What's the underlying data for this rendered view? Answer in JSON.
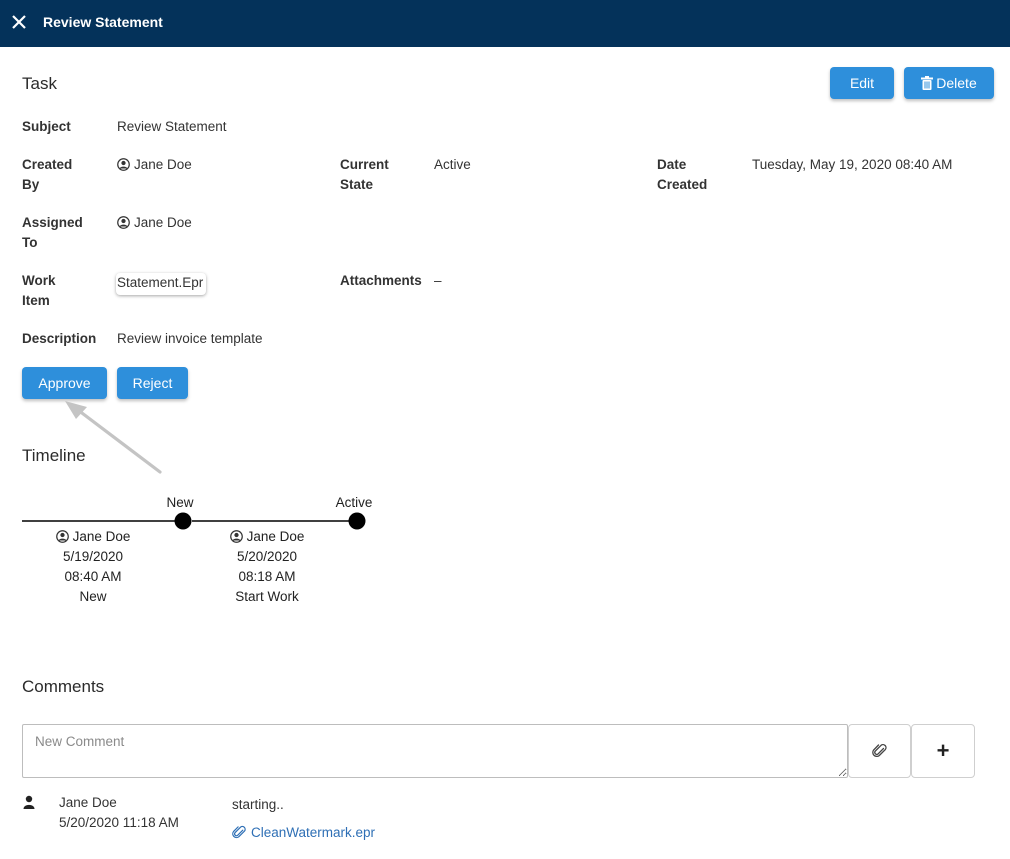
{
  "header": {
    "title": "Review Statement"
  },
  "task": {
    "heading": "Task",
    "edit_label": "Edit",
    "delete_label": "Delete",
    "subject_label": "Subject",
    "subject_value": "Review Statement",
    "created_by_label_1": "Created",
    "created_by_label_2": "By",
    "created_by_value": "Jane Doe",
    "current_state_label_1": "Current",
    "current_state_label_2": "State",
    "current_state_value": "Active",
    "date_created_label_1": "Date",
    "date_created_label_2": "Created",
    "date_created_value": "Tuesday, May 19, 2020 08:40 AM",
    "assigned_to_label_1": "Assigned",
    "assigned_to_label_2": "To",
    "assigned_to_value": "Jane Doe",
    "work_item_label_1": "Work",
    "work_item_label_2": "Item",
    "work_item_value": "Statement.Epr",
    "attachments_label": "Attachments",
    "attachments_value": "–",
    "description_label": "Description",
    "description_value": "Review invoice template",
    "approve_label": "Approve",
    "reject_label": "Reject"
  },
  "timeline": {
    "heading": "Timeline",
    "nodes": [
      {
        "state": "New",
        "user": "Jane Doe",
        "date": "5/19/2020",
        "time": "08:40 AM",
        "action": "New"
      },
      {
        "state": "Active",
        "user": "Jane Doe",
        "date": "5/20/2020",
        "time": "08:18 AM",
        "action": "Start Work"
      }
    ]
  },
  "comments": {
    "heading": "Comments",
    "placeholder": "New Comment",
    "add_symbol": "+",
    "items": [
      {
        "user": "Jane Doe",
        "datetime": "5/20/2020 11:18 AM",
        "text": "starting..",
        "attachment": "CleanWatermark.epr"
      }
    ]
  },
  "colors": {
    "header_bg": "#04325a",
    "primary_button": "#2e8fdb",
    "link": "#2e6fb5"
  },
  "icons": [
    "close-icon",
    "trash-icon",
    "user-circle-icon",
    "paperclip-icon",
    "plus-icon",
    "person-icon"
  ]
}
